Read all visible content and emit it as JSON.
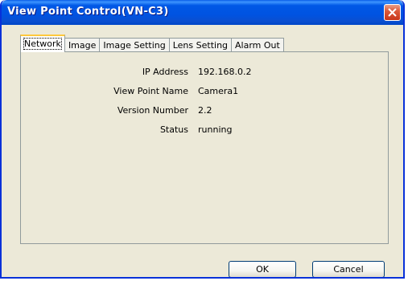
{
  "window": {
    "title": "View Point Control(VN-C3)"
  },
  "tabs": [
    {
      "label": "Network",
      "active": true
    },
    {
      "label": "Image",
      "active": false
    },
    {
      "label": "Image Setting",
      "active": false
    },
    {
      "label": "Lens Setting",
      "active": false
    },
    {
      "label": "Alarm Out",
      "active": false
    }
  ],
  "network": {
    "fields": [
      {
        "label": "IP Address",
        "value": "192.168.0.2"
      },
      {
        "label": "View Point Name",
        "value": "Camera1"
      },
      {
        "label": "Version Number",
        "value": "2.2"
      },
      {
        "label": "Status",
        "value": "running"
      }
    ]
  },
  "buttons": {
    "ok": "OK",
    "cancel": "Cancel"
  },
  "colors": {
    "titlebar": "#0054e3",
    "close": "#dc5a3a",
    "face": "#ece9d8",
    "active_tab_hilite": "#ffc83c"
  }
}
